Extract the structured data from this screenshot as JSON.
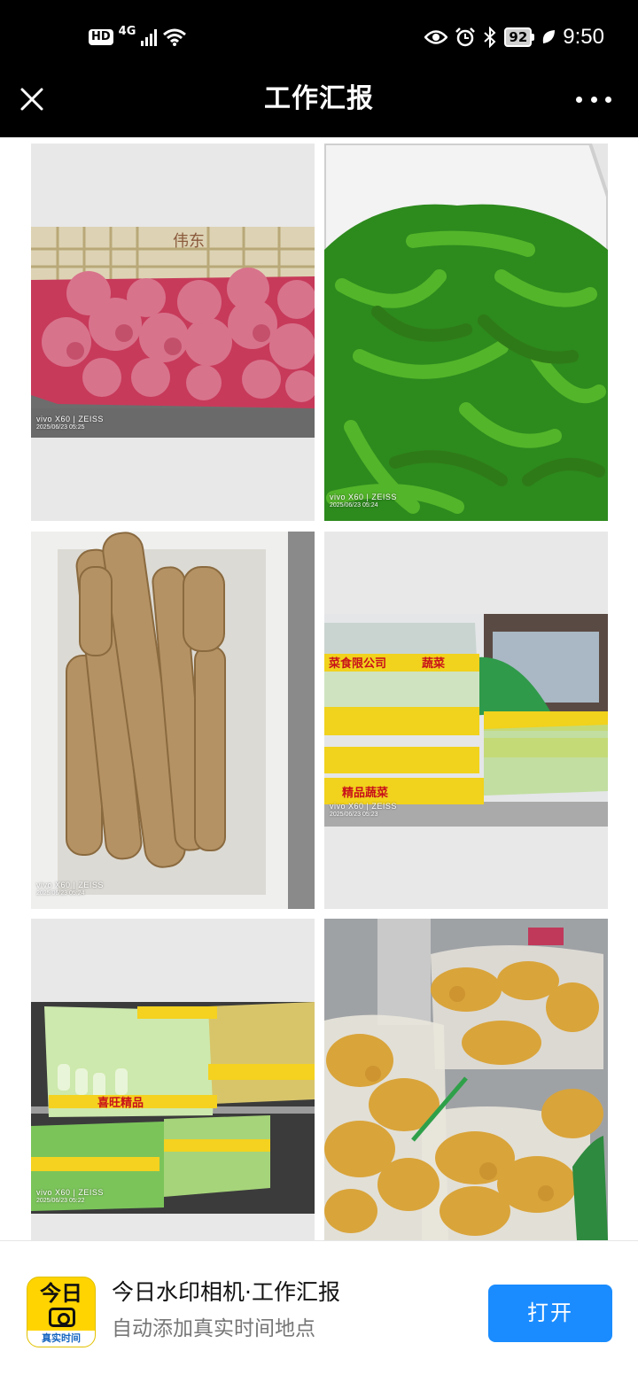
{
  "status_bar": {
    "hd": "HD",
    "network": "4G",
    "battery": "92",
    "time": "9:50"
  },
  "title_bar": {
    "title": "工作汇报"
  },
  "photos": [
    {
      "camera": "vivo X60 | ZEISS",
      "datetime": "2025/06/23 05:25"
    },
    {
      "camera": "vivo X60 | ZEISS",
      "datetime": "2025/06/23 05:24"
    },
    {
      "camera": "vivo X60 | ZEISS",
      "datetime": "2025/06/23 05:24"
    },
    {
      "camera": "vivo X60 | ZEISS",
      "datetime": "2025/06/23 05:23"
    },
    {
      "camera": "vivo X60 | ZEISS",
      "datetime": "2025/06/23 05:22"
    }
  ],
  "produce_labels": {
    "crate_brand": "伟东",
    "bag_print_1": "菜食限公司",
    "bag_print_2": "蔬菜",
    "bag_print_3": "精品蔬菜",
    "bag_print_4": "喜旺精品"
  },
  "banner": {
    "icon_top": "今日",
    "icon_bottom": "真实时间",
    "app_name": "今日水印相机·工作汇报",
    "app_desc": "自动添加真实时间地点",
    "open_label": "打开"
  }
}
